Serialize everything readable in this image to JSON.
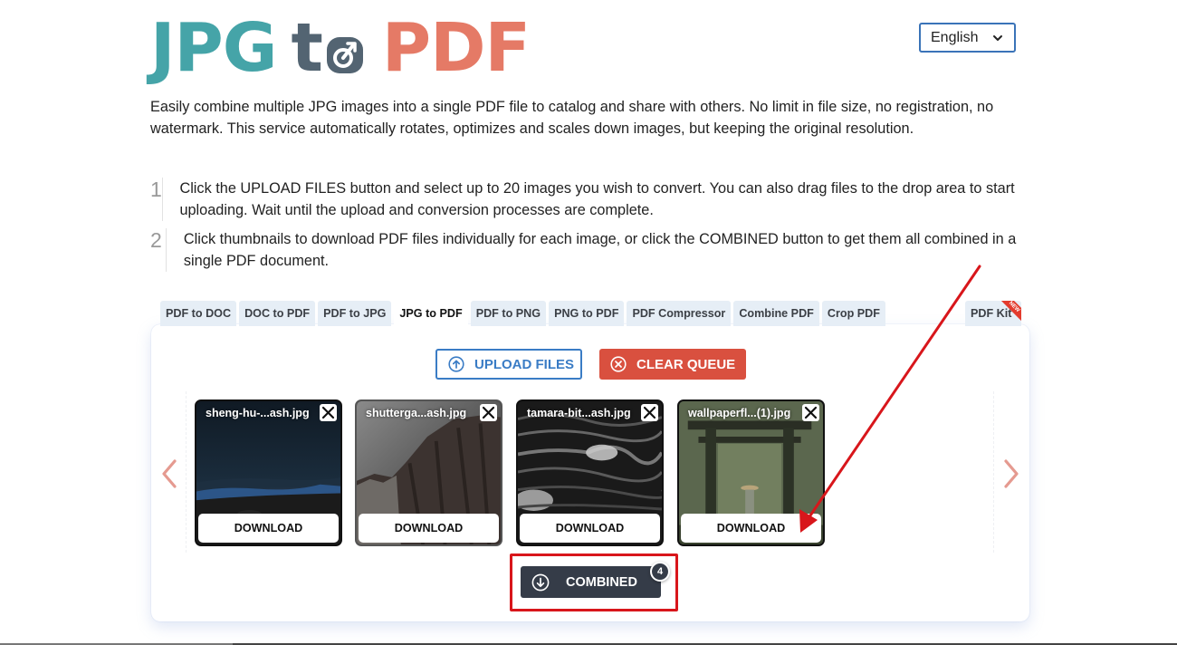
{
  "logo": {
    "part1": "JPG",
    "part2": "t",
    "part3": "PDF",
    "colors": {
      "jpg": "#45a4a8",
      "to": "#536472",
      "pdf": "#e57a66"
    }
  },
  "language_select": {
    "selected": "English",
    "icon": "chevron-down-icon"
  },
  "intro": "Easily combine multiple JPG images into a single PDF file to catalog and share with others. No limit in file size, no registration, no watermark. This service automatically rotates, optimizes and scales down images, but keeping the original resolution.",
  "steps": [
    {
      "number": "1",
      "text": "Click the UPLOAD FILES button and select up to 20 images you wish to convert. You can also drag files to the drop area to start uploading. Wait until the upload and conversion processes are complete."
    },
    {
      "number": "2",
      "text": "Click thumbnails to download PDF files individually for each image, or click the COMBINED button to get them all combined in a single PDF document."
    }
  ],
  "tabs": [
    {
      "label": "PDF to DOC",
      "active": false
    },
    {
      "label": "DOC to PDF",
      "active": false
    },
    {
      "label": "PDF to JPG",
      "active": false
    },
    {
      "label": "JPG to PDF",
      "active": true
    },
    {
      "label": "PDF to PNG",
      "active": false
    },
    {
      "label": "PNG to PDF",
      "active": false
    },
    {
      "label": "PDF Compressor",
      "active": false
    },
    {
      "label": "Combine PDF",
      "active": false
    },
    {
      "label": "Crop PDF",
      "active": false
    }
  ],
  "tab_kit": {
    "label": "PDF Kit",
    "ribbon": "NEW"
  },
  "toolbar": {
    "upload_label": "UPLOAD FILES",
    "upload_icon": "arrow-up-circle-icon",
    "clear_label": "CLEAR QUEUE",
    "clear_icon": "x-circle-icon",
    "upload_color": "#3a7cc5",
    "clear_color": "#d9503f"
  },
  "carousel": {
    "prev_icon": "chevron-left-icon",
    "next_icon": "chevron-right-icon",
    "files": [
      {
        "name": "sheng-hu-...ash.jpg",
        "download_label": "DOWNLOAD",
        "scene": "night-beach"
      },
      {
        "name": "shutterga...ash.jpg",
        "download_label": "DOWNLOAD",
        "scene": "rock-cliff"
      },
      {
        "name": "tamara-bit...ash.jpg",
        "download_label": "DOWNLOAD",
        "scene": "ocean-waves"
      },
      {
        "name": "wallpaperfl...(1).jpg",
        "download_label": "DOWNLOAD",
        "scene": "torii-forest"
      }
    ]
  },
  "combined": {
    "label": "COMBINED",
    "icon": "arrow-down-circle-icon",
    "count": "4",
    "color": "#353c48"
  },
  "annotation": {
    "highlight_color": "#d8161b",
    "arrow_color": "#d8161b"
  }
}
